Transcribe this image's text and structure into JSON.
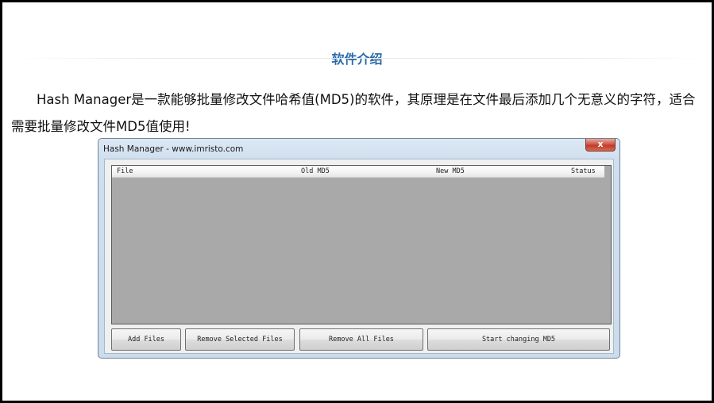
{
  "section": {
    "title": "软件介绍"
  },
  "intro": {
    "text": "Hash Manager是一款能够批量修改文件哈希值(MD5)的软件，其原理是在文件最后添加几个无意义的字符，适合需要批量修改文件MD5值使用!"
  },
  "window": {
    "title": "Hash Manager - www.imristo.com",
    "close_label": "x",
    "columns": [
      "File",
      "Old MD5",
      "New MD5",
      "Status"
    ],
    "buttons": {
      "add_files": "Add Files",
      "remove_selected": "Remove Selected Files",
      "remove_all": "Remove All Files",
      "start_changing": "Start changing MD5"
    }
  },
  "colors": {
    "title_accent": "#2a6aa8",
    "listview_bg": "#a9a9a9"
  }
}
